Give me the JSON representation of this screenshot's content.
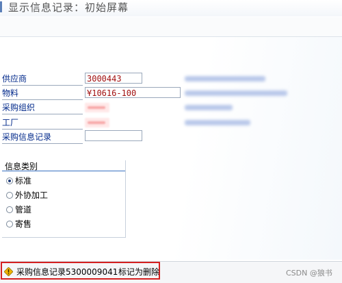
{
  "window": {
    "title": "显示信息记录：初始屏幕",
    "title_icon": "title-marker-icon"
  },
  "form": {
    "vendor_label": "供应商",
    "vendor_value": "3000443",
    "material_label": "物料",
    "material_value": "¥10616-100",
    "purch_org_label": "采购组织",
    "plant_label": "工厂",
    "info_record_label": "采购信息记录",
    "info_record_value": ""
  },
  "info_category": {
    "title": "信息类别",
    "selected": "标准",
    "options": [
      "标准",
      "外协加工",
      "管道",
      "寄售"
    ]
  },
  "status": {
    "icon": "warning-diamond-icon",
    "message": "采购信息记录5300009041",
    "message_suffix": "标记为删除",
    "highlight_color": "#d42020"
  },
  "watermark": {
    "text": "CSDN @狼书"
  },
  "colors": {
    "label_blue": "#00288a",
    "value_red": "#a11010",
    "group_line": "#3870c0"
  }
}
